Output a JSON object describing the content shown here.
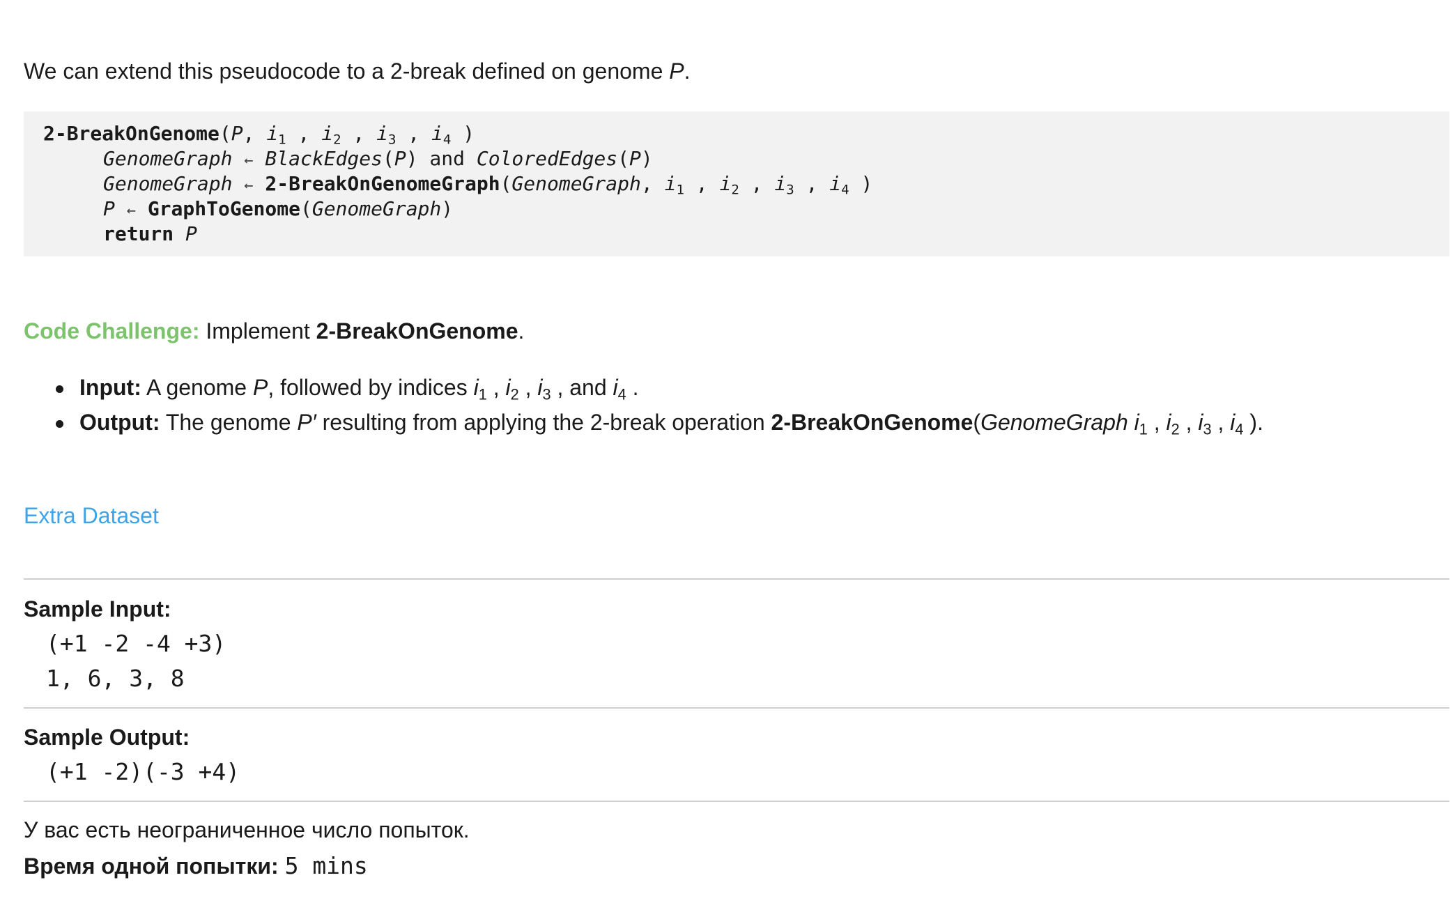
{
  "intro": {
    "text": "We can extend this pseudocode to a 2-break defined on genome ",
    "var": "P",
    "end": "."
  },
  "pseudocode": {
    "fn_name": "2-BreakOnGenome",
    "param_P": "P",
    "sep": ", ",
    "i": "i",
    "sub1": "1",
    "sub2": "2",
    "sub3": "3",
    "sub4": "4",
    "genome_graph": "GenomeGraph",
    "arrow": "←",
    "black_edges": "BlackEdges",
    "and": "and",
    "colored_edges": "ColoredEdges",
    "graph_fn": "2-BreakOnGenomeGraph",
    "graph_to_genome": "GraphToGenome",
    "return_kw": "return",
    "open": "(",
    "close": ")"
  },
  "challenge": {
    "title": "Code Challenge:",
    "text": " Implement ",
    "name": "2-BreakOnGenome",
    "end": "."
  },
  "bullets": {
    "input_label": "Input:",
    "input_text_1": " A genome ",
    "input_var": "P",
    "input_text_2": ", followed by indices ",
    "input_and": "and ",
    "output_label": "Output:",
    "output_text_1": " The genome ",
    "output_var": "P′",
    "output_text_2": " resulting from applying the 2-break operation ",
    "output_fn": "2-BreakOnGenome",
    "output_graph": "GenomeGraph "
  },
  "extra_dataset": "Extra Dataset",
  "sample_input": {
    "title": "Sample Input:",
    "lines": [
      "(+1 -2 -4 +3)",
      "1, 6, 3, 8"
    ]
  },
  "sample_output": {
    "title": "Sample Output:",
    "lines": [
      "(+1 -2)(-3 +4)"
    ]
  },
  "attempts": "У вас есть неограниченное число попыток.",
  "time": {
    "label": "Время одной попытки:",
    "value": "5 mins"
  },
  "colors": {
    "challenge_title": "#7dc36d",
    "link": "#3fa3e8",
    "code_bg": "#f2f2f2"
  }
}
